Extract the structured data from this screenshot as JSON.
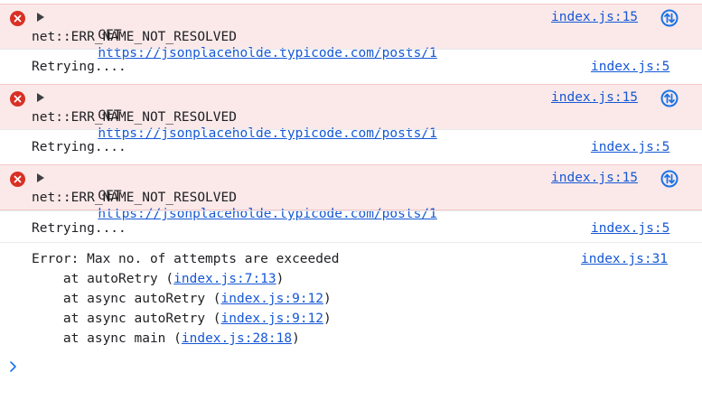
{
  "errors": [
    {
      "method": "GET",
      "url": "https://jsonplaceholde.typicode.com/posts/1",
      "message": "net::ERR_NAME_NOT_RESOLVED",
      "source": "index.js:15"
    },
    {
      "method": "GET",
      "url": "https://jsonplaceholde.typicode.com/posts/1",
      "message": "net::ERR_NAME_NOT_RESOLVED",
      "source": "index.js:15"
    },
    {
      "method": "GET",
      "url": "https://jsonplaceholde.typicode.com/posts/1",
      "message": "net::ERR_NAME_NOT_RESOLVED",
      "source": "index.js:15"
    }
  ],
  "retries": [
    {
      "text": "Retrying....",
      "source": "index.js:5"
    },
    {
      "text": "Retrying....",
      "source": "index.js:5"
    },
    {
      "text": "Retrying....",
      "source": "index.js:5"
    }
  ],
  "final_error": {
    "message": "Error: Max no. of attempts are exceeded",
    "source": "index.js:31",
    "stack": [
      {
        "prefix": "    at autoRetry (",
        "link": "index.js:7:13",
        "suffix": ")"
      },
      {
        "prefix": "    at async autoRetry (",
        "link": "index.js:9:12",
        "suffix": ")"
      },
      {
        "prefix": "    at async autoRetry (",
        "link": "index.js:9:12",
        "suffix": ")"
      },
      {
        "prefix": "    at async main (",
        "link": "index.js:28:18",
        "suffix": ")"
      }
    ]
  },
  "colors": {
    "error_bg": "#fbe9e9",
    "error_icon": "#d93025",
    "link": "#1558d6",
    "prompt": "#1a73e8"
  },
  "icons": {
    "error": "error-circle-x-icon",
    "expand": "expand-triangle-icon",
    "network": "network-request-icon",
    "prompt": "chevron-right-prompt-icon"
  }
}
